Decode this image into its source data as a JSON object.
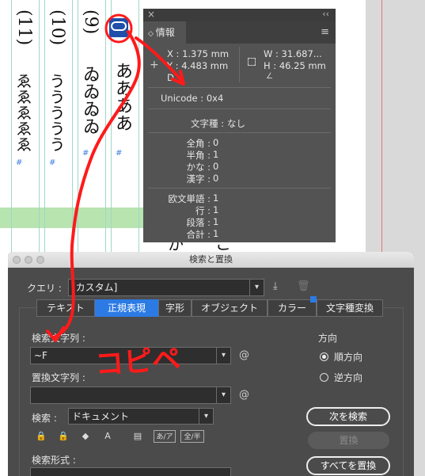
{
  "document": {
    "columns": [
      {
        "number": "(11)",
        "text": "ゑゑゑゑゑ"
      },
      {
        "number": "(10)",
        "text": "ううううう"
      },
      {
        "number": "(9)",
        "text": "ゐゐゐゐ"
      },
      {
        "number": "",
        "text": "ああああ"
      }
    ],
    "extra_glyph": "か",
    "extra_glyph2": "こ",
    "marker": "#",
    "highlight_glyph": "ooo"
  },
  "info_panel": {
    "title": "情報",
    "collapse_arrows": "‹‹",
    "close": "×",
    "menu_icon": "≡",
    "x": "X : 1.375 mm",
    "y": "Y : 4.483 mm",
    "d": "D",
    "w": "W : 31.687...",
    "h": "H : 46.25 mm",
    "unicode": "Unicode : 0x4",
    "char_type_label": "文字種 :",
    "char_type_value": "なし",
    "counts": [
      {
        "label": "全角 :",
        "value": "0"
      },
      {
        "label": "半角 :",
        "value": "1"
      },
      {
        "label": "かな :",
        "value": "0"
      },
      {
        "label": "漢字 :",
        "value": "0"
      }
    ],
    "words": [
      {
        "label": "欧文単語 :",
        "value": "1"
      },
      {
        "label": "行 :",
        "value": "1"
      },
      {
        "label": "段落 :",
        "value": "1"
      },
      {
        "label": "合計 :",
        "value": "1"
      }
    ]
  },
  "dialog": {
    "title": "検索と置換",
    "query_label": "クエリ :",
    "query_value": "[カスタム]",
    "tabs": [
      "テキスト",
      "正規表現",
      "字形",
      "オブジェクト",
      "カラー",
      "文字種変換"
    ],
    "active_tab": 1,
    "search_label": "検索文字列 :",
    "search_value": "~F",
    "replace_label": "置換文字列 :",
    "replace_value": "",
    "direction_label": "方向",
    "forward": "順方向",
    "backward": "逆方向",
    "scope_label": "検索 :",
    "scope_value": "ドキュメント",
    "format_label": "検索形式 :",
    "find_next": "次を検索",
    "replace": "置換",
    "replace_all": "すべてを置換",
    "option_icons": [
      "🔒",
      "🔒",
      "◆",
      "A",
      "▤",
      "あ/ア",
      "全/半"
    ],
    "at_symbol": "@"
  },
  "annotation": {
    "text": "コピペ",
    "color": "#ff1a1a"
  }
}
